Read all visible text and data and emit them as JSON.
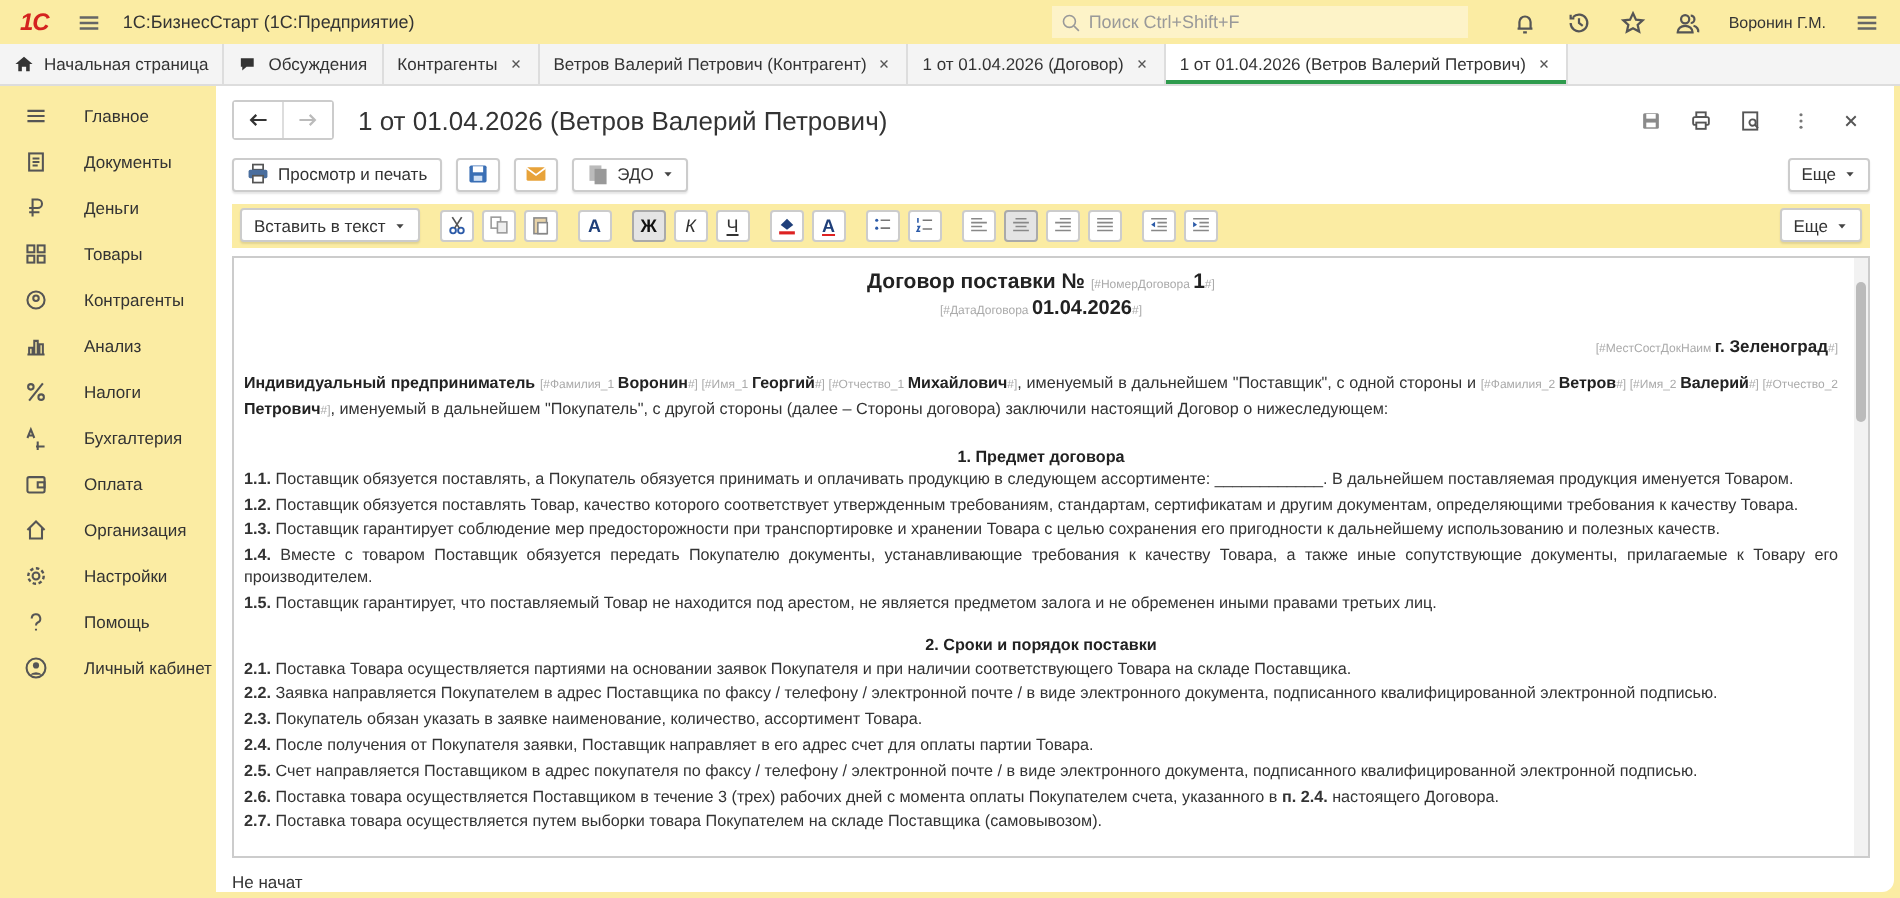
{
  "app": {
    "logo": "1С",
    "title": "1С:БизнесСтарт  (1С:Предприятие)",
    "search": {
      "placeholder": "Поиск Ctrl+Shift+F"
    },
    "user": "Воронин Г.М."
  },
  "tabs": [
    {
      "label": "Начальная страница",
      "kind": "home",
      "selected": false
    },
    {
      "label": "Обсуждения",
      "kind": "chat",
      "selected": false
    },
    {
      "label": "Контрагенты",
      "kind": "closable",
      "selected": false
    },
    {
      "label": "Ветров Валерий Петрович (Контрагент)",
      "kind": "closable",
      "selected": false
    },
    {
      "label": "1 от 01.04.2026 (Договор)",
      "kind": "closable",
      "selected": false
    },
    {
      "label": "1 от 01.04.2026 (Ветров Валерий Петрович)",
      "kind": "closable",
      "selected": true
    }
  ],
  "sidebar": {
    "items": [
      {
        "label": "Главное",
        "kind": "menu"
      },
      {
        "label": "Документы",
        "kind": "docs"
      },
      {
        "label": "Деньги",
        "kind": "ruble"
      },
      {
        "label": "Товары",
        "kind": "goods"
      },
      {
        "label": "Контрагенты",
        "kind": "partners"
      },
      {
        "label": "Анализ",
        "kind": "chart"
      },
      {
        "label": "Налоги",
        "kind": "percent"
      },
      {
        "label": "Бухгалтерия",
        "kind": "accounting"
      },
      {
        "label": "Оплата",
        "kind": "wallet"
      },
      {
        "label": "Организация",
        "kind": "house"
      },
      {
        "label": "Настройки",
        "kind": "gear"
      },
      {
        "label": "Помощь",
        "kind": "help"
      },
      {
        "label": "Личный кабинет",
        "kind": "account"
      }
    ]
  },
  "form": {
    "title": "1 от 01.04.2026 (Ветров Валерий Петрович)",
    "print_button": "Просмотр и печать",
    "edo_button": "ЭДО",
    "more": "Еще"
  },
  "editor": {
    "insert_button": "Вставить в текст",
    "more": "Еще",
    "groups": [
      {
        "tools": [
          {
            "kind": "cut",
            "selected": false
          },
          {
            "kind": "copy",
            "selected": false
          },
          {
            "kind": "paste",
            "selected": false
          }
        ]
      },
      {
        "tools": [
          {
            "kind": "font",
            "label": "A",
            "selected": false
          }
        ]
      },
      {
        "tools": [
          {
            "kind": "bold",
            "label": "Ж",
            "selected": true
          },
          {
            "kind": "italic",
            "label": "К",
            "selected": false
          },
          {
            "kind": "underline",
            "label": "Ч",
            "selected": false
          }
        ]
      },
      {
        "tools": [
          {
            "kind": "fill",
            "selected": false
          },
          {
            "kind": "color",
            "label": "A",
            "selected": false
          }
        ]
      },
      {
        "tools": [
          {
            "kind": "bullets",
            "selected": false
          },
          {
            "kind": "numbers",
            "selected": false
          }
        ]
      },
      {
        "tools": [
          {
            "kind": "align-left",
            "selected": false
          },
          {
            "kind": "align-center",
            "selected": true
          },
          {
            "kind": "align-right",
            "selected": false
          },
          {
            "kind": "justify",
            "selected": false
          }
        ]
      },
      {
        "tools": [
          {
            "kind": "outdent",
            "selected": false
          },
          {
            "kind": "indent",
            "selected": false
          }
        ]
      }
    ]
  },
  "document": {
    "blocks": [
      {
        "kind": "title",
        "segments": [
          {
            "kind": "bold",
            "text": "Договор поставки № "
          },
          {
            "kind": "tag",
            "text": "[#НомерДоговора "
          },
          {
            "kind": "bold",
            "text": "1"
          },
          {
            "kind": "tag",
            "text": "#]"
          }
        ]
      },
      {
        "kind": "subtitle",
        "segments": [
          {
            "kind": "tag",
            "text": "[#ДатаДоговора "
          },
          {
            "kind": "bold",
            "text": "01.04.2026"
          },
          {
            "kind": "tag",
            "text": "#]"
          }
        ]
      },
      {
        "kind": "place",
        "segments": [
          {
            "kind": "tag",
            "text": "[#МестСостДокНаим "
          },
          {
            "kind": "bold",
            "text": "г. Зеленоград"
          },
          {
            "kind": "tag",
            "text": "#]"
          }
        ]
      },
      {
        "kind": "paragraph",
        "segments": [
          {
            "kind": "bold",
            "text": "Индивидуальный предприниматель "
          },
          {
            "kind": "tag",
            "text": "[#Фамилия_1 "
          },
          {
            "kind": "bold",
            "text": "Воронин"
          },
          {
            "kind": "tag",
            "text": "#] [#Имя_1 "
          },
          {
            "kind": "bold",
            "text": "Георгий"
          },
          {
            "kind": "tag",
            "text": "#] [#Отчество_1 "
          },
          {
            "kind": "bold",
            "text": "Михайлович"
          },
          {
            "kind": "tag",
            "text": "#]"
          },
          {
            "kind": "plain",
            "text": ", именуемый в дальнейшем \"Поставщик\", с одной стороны и "
          },
          {
            "kind": "tag",
            "text": "[#Фамилия_2 "
          },
          {
            "kind": "bold",
            "text": "Ветров"
          },
          {
            "kind": "tag",
            "text": "#] [#Имя_2 "
          },
          {
            "kind": "bold",
            "text": "Валерий"
          },
          {
            "kind": "tag",
            "text": "#] [#Отчество_2 "
          },
          {
            "kind": "bold",
            "text": "Петрович"
          },
          {
            "kind": "tag",
            "text": "#]"
          },
          {
            "kind": "plain",
            "text": ", именуемый в дальнейшем \"Покупатель\", с другой стороны (далее – Стороны договора) заключили настоящий Договор о нижеследующем:"
          }
        ]
      },
      {
        "kind": "heading",
        "text": "1. Предмет договора"
      },
      {
        "kind": "clause",
        "text": "**1.1.** Поставщик обязуется поставлять, а Покупатель обязуется принимать и оплачивать продукцию в следующем ассортименте: ____________. В дальнейшем поставляемая продукция именуется Товаром."
      },
      {
        "kind": "clause",
        "text": "**1.2.** Поставщик обязуется поставлять Товар, качество которого соответствует утвержденным требованиям, стандартам, сертификатам и другим документам, определяющими требования к качеству Товара."
      },
      {
        "kind": "clause",
        "text": "**1.3.** Поставщик гарантирует соблюдение мер предосторожности при транспортировке и хранении Товара с целью сохранения его пригодности к дальнейшему использованию и полезных качеств."
      },
      {
        "kind": "clause",
        "text": "**1.4.** Вместе с товаром Поставщик обязуется передать Покупателю документы, устанавливающие требования к качеству Товара, а также иные сопутствующие документы, прилагаемые к Товару его производителем."
      },
      {
        "kind": "clause",
        "text": "**1.5.** Поставщик гарантирует, что поставляемый Товар не находится под арестом, не является предметом залога и не обременен иными правами третьих лиц."
      },
      {
        "kind": "heading",
        "text": "2. Сроки и порядок поставки"
      },
      {
        "kind": "clause",
        "text": "**2.1.** Поставка Товара осуществляется партиями на основании заявок Покупателя и при наличии соответствующего Товара на складе Поставщика."
      },
      {
        "kind": "clause",
        "text": "**2.2.** Заявка направляется Покупателем в адрес Поставщика по факсу / телефону / электронной почте / в виде электронного документа, подписанного квалифицированной электронной подписью."
      },
      {
        "kind": "clause",
        "text": "**2.3.** Покупатель обязан указать в заявке наименование, количество, ассортимент Товара."
      },
      {
        "kind": "clause",
        "text": "**2.4.** После получения от Покупателя заявки, Поставщик направляет в его адрес счет для оплаты партии Товара."
      },
      {
        "kind": "clause",
        "text": "**2.5.** Счет направляется Поставщиком в адрес покупателя по факсу / телефону / электронной почте / в виде электронного документа, подписанного квалифицированной электронной подписью."
      },
      {
        "kind": "clause",
        "text": "**2.6.** Поставка товара осуществляется Поставщиком в течение 3 (трех) рабочих дней с момента оплаты Покупателем счета, указанного в **п. 2.4.** настоящего Договора."
      },
      {
        "kind": "clause",
        "text": "**2.7.** Поставка товара осуществляется путем выборки товара Покупателем на складе Поставщика (самовывозом)."
      }
    ]
  },
  "status": "Не начат"
}
